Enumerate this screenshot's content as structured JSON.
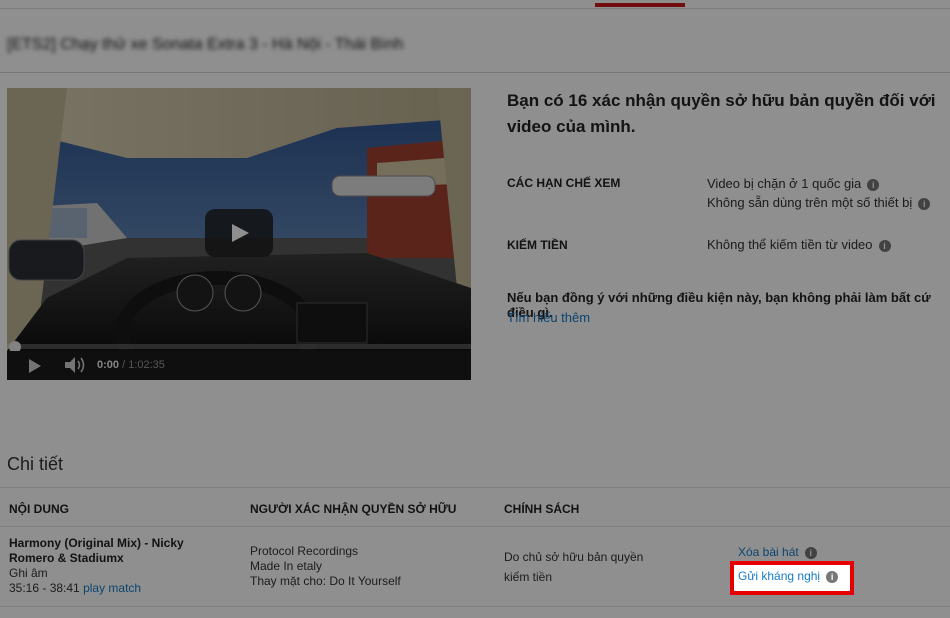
{
  "header": {
    "video_title": "[ETS2] Chạy thử xe Sonata Extra 3 - Hà Nội - Thái Bình"
  },
  "player": {
    "current_time": "0:00",
    "duration": "/ 1:02:35",
    "progress_fraction": 0.0
  },
  "summary": {
    "heading": "Bạn có 16 xác nhận quyền sở hữu bản quyền đối với video của mình.",
    "restrictions_label": "CÁC HẠN CHẾ XEM",
    "restrictions": [
      "Video bị chặn ở 1 quốc gia",
      "Không sẵn dùng trên một số thiết bị"
    ],
    "monetization_label": "KIẾM TIỀN",
    "monetization_value": "Không thể kiếm tiền từ video",
    "agree_text": "Nếu bạn đồng ý với những điều kiện này, bạn không phải làm bất cứ điều gì.",
    "learn_more": "Tìm hiểu thêm"
  },
  "details": {
    "title": "Chi tiết",
    "columns": [
      "NỘI DUNG",
      "NGƯỜI XÁC NHẬN QUYỀN SỞ HỮU",
      "CHÍNH SÁCH"
    ],
    "row": {
      "song": "Harmony (Original Mix) - Nicky Romero & Stadiumx",
      "type": "Ghi âm",
      "range": "35:16 - 38:41",
      "play_match": "play match",
      "claimant_lines": [
        "Protocol Recordings",
        "Made In etaly",
        "Thay mặt cho: Do It Yourself"
      ],
      "policy_lines": [
        "Do chủ sở hữu bản quyền",
        "kiếm tiền"
      ],
      "action_remove": "Xóa bài hát",
      "action_dispute": "Gửi kháng nghị"
    }
  },
  "icons": {
    "info": "info-icon",
    "play": "play-icon",
    "volume": "volume-icon"
  },
  "colors": {
    "link": "#167ac6",
    "highlight_border": "#e60000",
    "tab_indicator": "#cc181e"
  }
}
